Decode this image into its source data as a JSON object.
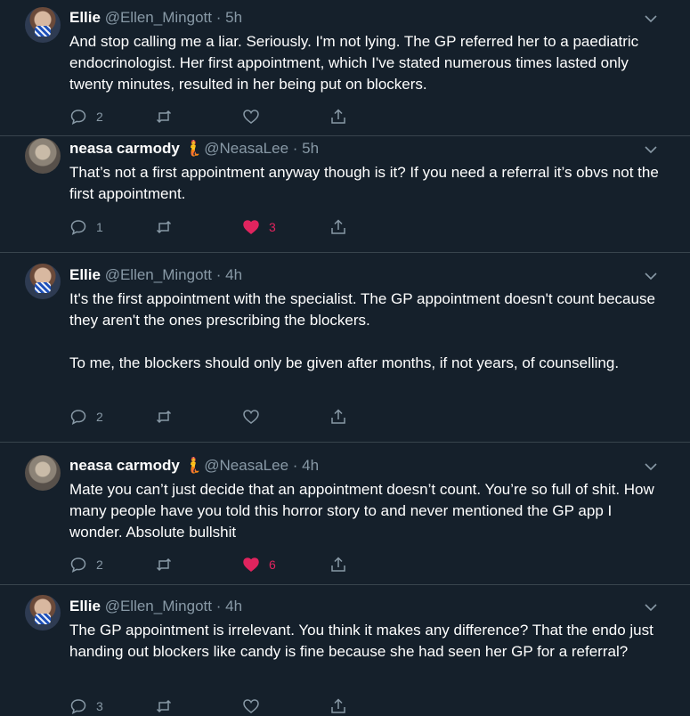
{
  "colors": {
    "background": "#15202b",
    "text": "#ffffff",
    "muted": "#8899a6",
    "like": "#e0245e",
    "divider": "#38444d"
  },
  "tweets": [
    {
      "name": "Ellie",
      "handle": "@Ellen_Mingott",
      "time": "5h",
      "emoji": "",
      "paragraphs": [
        "And stop calling me a liar. Seriously. I'm not lying. The GP referred her to a paediatric endocrinologist. Her first appointment, which I've stated numerous times lasted only twenty minutes, resulted in her being put on blockers."
      ],
      "replies": "2",
      "retweets": "",
      "likes": "",
      "liked": false
    },
    {
      "name": "neasa carmody",
      "handle": "@NeasaLee",
      "time": "5h",
      "emoji": "mermaid-emoji",
      "paragraphs": [
        "That’s not a first appointment anyway though is it? If you need a referral it’s obvs not the first appointment."
      ],
      "replies": "1",
      "retweets": "",
      "likes": "3",
      "liked": true
    },
    {
      "name": "Ellie",
      "handle": "@Ellen_Mingott",
      "time": "4h",
      "emoji": "",
      "paragraphs": [
        "It's the first appointment with the specialist. The GP appointment doesn't count because they aren't the ones prescribing the blockers.",
        "To me, the blockers should only be given after months, if not years, of counselling."
      ],
      "replies": "2",
      "retweets": "",
      "likes": "",
      "liked": false
    },
    {
      "name": "neasa carmody",
      "handle": "@NeasaLee",
      "time": "4h",
      "emoji": "mermaid-emoji",
      "paragraphs": [
        "Mate you can’t just decide that an appointment doesn’t count. You’re so full of shit. How many people have you told this horror story to and never mentioned the GP app I wonder. Absolute bullshit"
      ],
      "replies": "2",
      "retweets": "",
      "likes": "6",
      "liked": true
    },
    {
      "name": "Ellie",
      "handle": "@Ellen_Mingott",
      "time": "4h",
      "emoji": "",
      "paragraphs": [
        "The GP appointment is irrelevant. You think it makes any difference? That the endo just handing out blockers like candy is fine because she had seen her GP for a referral?"
      ],
      "replies": "3",
      "retweets": "",
      "likes": "",
      "liked": false
    }
  ],
  "separator": "·"
}
